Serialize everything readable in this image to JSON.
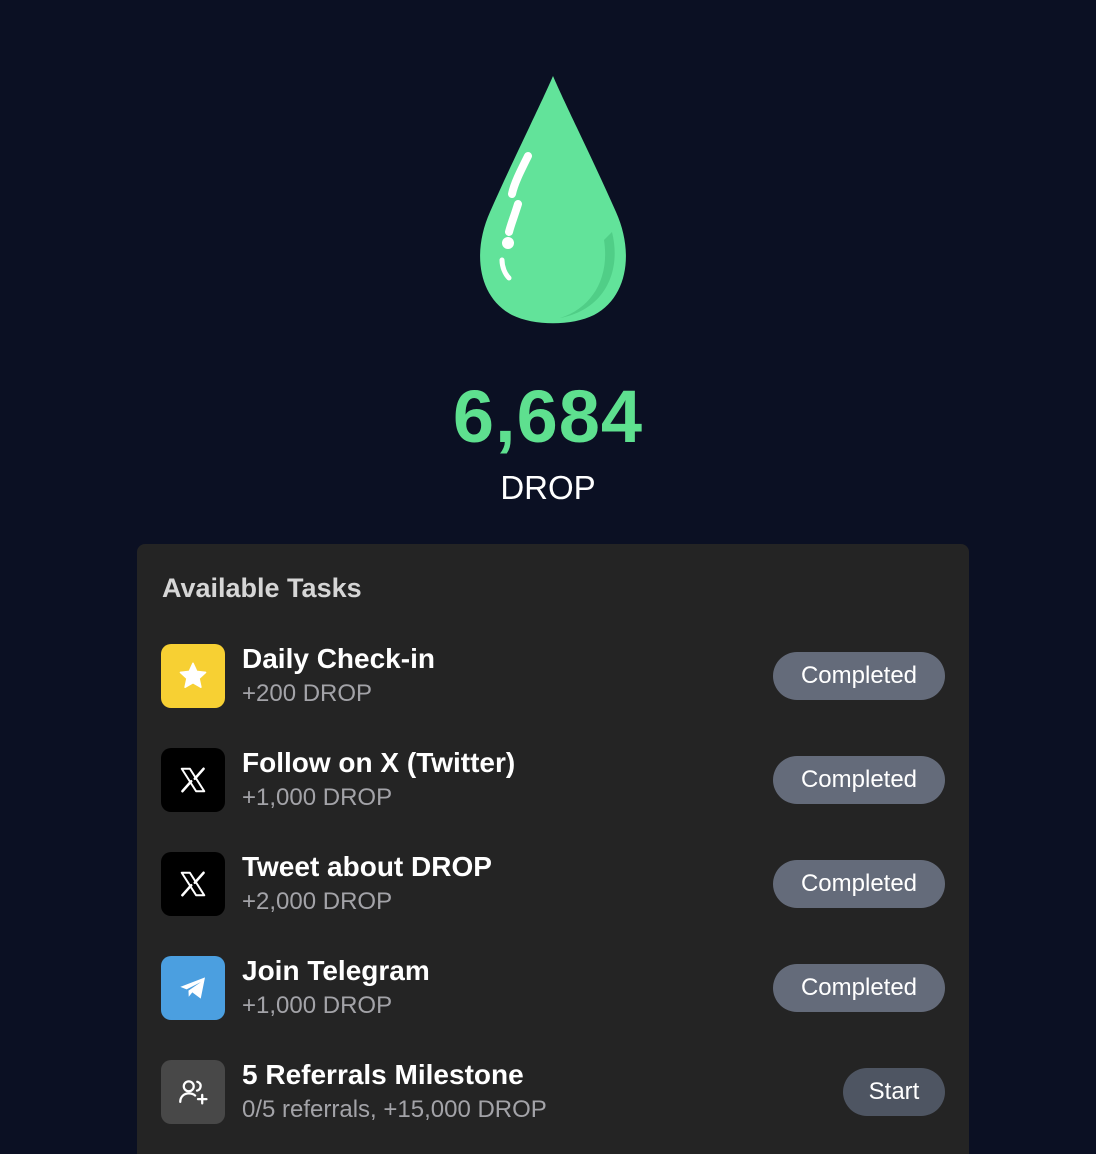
{
  "balance": {
    "value": "6,684",
    "unit": "DROP"
  },
  "tasks_section": {
    "title": "Available Tasks",
    "tasks": [
      {
        "name": "Daily Check-in",
        "reward": "+200 DROP",
        "action": "Completed",
        "icon": "star-icon",
        "icon_bg": "#f7d033"
      },
      {
        "name": "Follow on X (Twitter)",
        "reward": "+1,000 DROP",
        "action": "Completed",
        "icon": "x-logo-icon",
        "icon_bg": "#000000"
      },
      {
        "name": "Tweet about DROP",
        "reward": "+2,000 DROP",
        "action": "Completed",
        "icon": "x-logo-icon",
        "icon_bg": "#000000"
      },
      {
        "name": "Join Telegram",
        "reward": "+1,000 DROP",
        "action": "Completed",
        "icon": "telegram-icon",
        "icon_bg": "#4b9fe0"
      },
      {
        "name": "5 Referrals Milestone",
        "reward": "0/5 referrals, +15,000 DROP",
        "action": "Start",
        "icon": "user-plus-icon",
        "icon_bg": "#484848"
      }
    ]
  },
  "colors": {
    "background": "#0b1023",
    "accent_green": "#5ee08f",
    "card": "#242424",
    "button_completed": "#646b7a",
    "button_start": "#4e5562"
  }
}
